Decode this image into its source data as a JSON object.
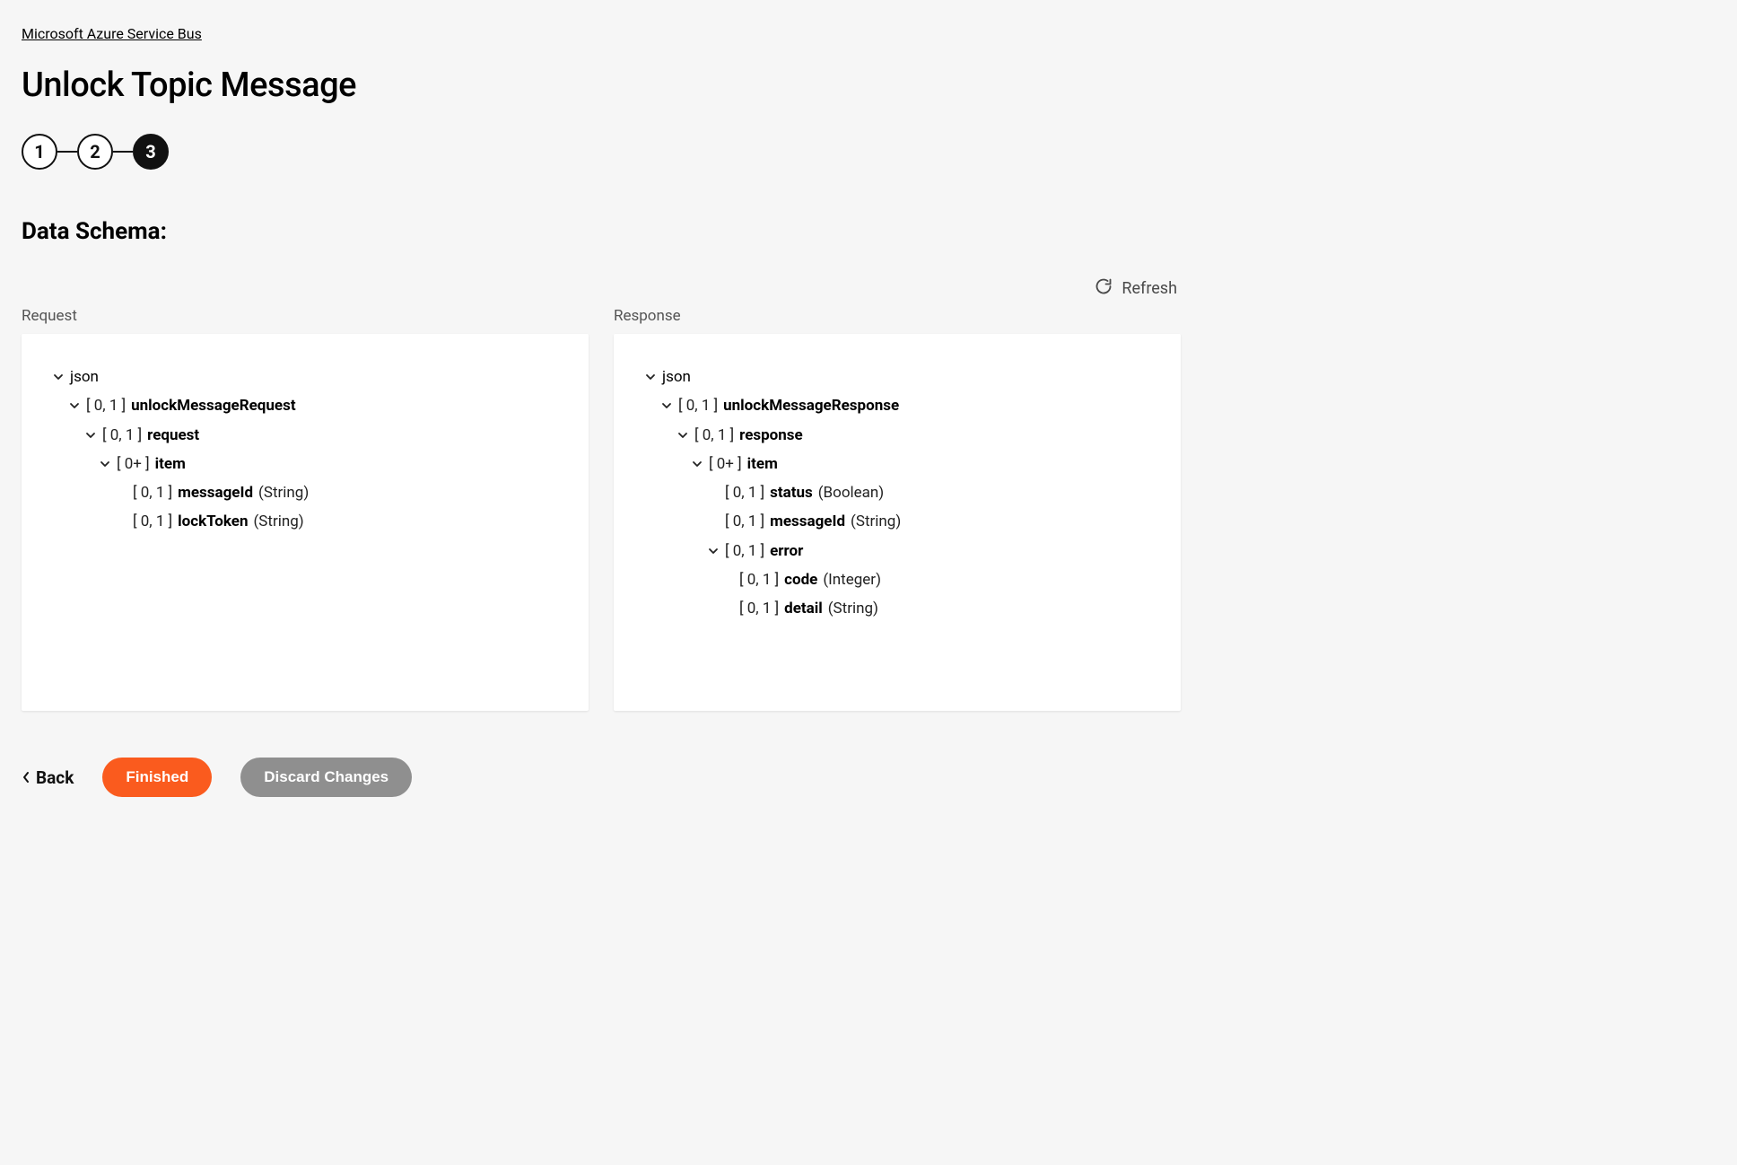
{
  "breadcrumb": "Microsoft Azure Service Bus",
  "page_title": "Unlock Topic Message",
  "stepper": {
    "steps": [
      "1",
      "2",
      "3"
    ],
    "active_index": 2
  },
  "section_title": "Data Schema:",
  "refresh_label": "Refresh",
  "panels": {
    "request": {
      "label": "Request",
      "tree": [
        {
          "indent": 0,
          "caret": true,
          "card": "",
          "name": "json",
          "bold": false,
          "type": ""
        },
        {
          "indent": 1,
          "caret": true,
          "card": "[ 0, 1 ]",
          "name": "unlockMessageRequest",
          "bold": true,
          "type": ""
        },
        {
          "indent": 2,
          "caret": true,
          "card": "[ 0, 1 ]",
          "name": "request",
          "bold": true,
          "type": ""
        },
        {
          "indent": 3,
          "caret": true,
          "card": "[ 0+ ]",
          "name": "item",
          "bold": true,
          "type": ""
        },
        {
          "indent": 4,
          "caret": false,
          "card": "[ 0, 1 ]",
          "name": "messageId",
          "bold": true,
          "type": "(String)"
        },
        {
          "indent": 4,
          "caret": false,
          "card": "[ 0, 1 ]",
          "name": "lockToken",
          "bold": true,
          "type": "(String)"
        }
      ]
    },
    "response": {
      "label": "Response",
      "tree": [
        {
          "indent": 0,
          "caret": true,
          "card": "",
          "name": "json",
          "bold": false,
          "type": ""
        },
        {
          "indent": 1,
          "caret": true,
          "card": "[ 0, 1 ]",
          "name": "unlockMessageResponse",
          "bold": true,
          "type": ""
        },
        {
          "indent": 2,
          "caret": true,
          "card": "[ 0, 1 ]",
          "name": "response",
          "bold": true,
          "type": ""
        },
        {
          "indent": 3,
          "caret": true,
          "card": "[ 0+ ]",
          "name": "item",
          "bold": true,
          "type": ""
        },
        {
          "indent": 4,
          "caret": false,
          "card": "[ 0, 1 ]",
          "name": "status",
          "bold": true,
          "type": "(Boolean)"
        },
        {
          "indent": 4,
          "caret": false,
          "card": "[ 0, 1 ]",
          "name": "messageId",
          "bold": true,
          "type": "(String)"
        },
        {
          "indent": 4,
          "caret": true,
          "card": "[ 0, 1 ]",
          "name": "error",
          "bold": true,
          "type": ""
        },
        {
          "indent": 5,
          "caret": false,
          "card": "[ 0, 1 ]",
          "name": "code",
          "bold": true,
          "type": "(Integer)"
        },
        {
          "indent": 5,
          "caret": false,
          "card": "[ 0, 1 ]",
          "name": "detail",
          "bold": true,
          "type": "(String)"
        }
      ]
    }
  },
  "footer": {
    "back": "Back",
    "finished": "Finished",
    "discard": "Discard Changes"
  },
  "colors": {
    "primary": "#fa5b1e",
    "secondary": "#8f8f8f",
    "bg": "#f6f6f6"
  }
}
